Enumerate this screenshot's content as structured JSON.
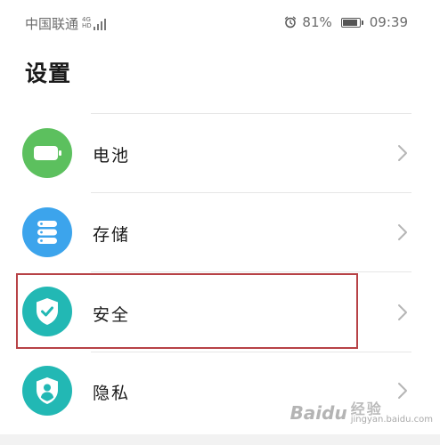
{
  "status_bar": {
    "carrier": "中国联通",
    "network_top": "4G",
    "network_bottom": "HD",
    "battery_percent": "81%",
    "time": "09:39",
    "icons": [
      "signal-icon",
      "alarm-icon",
      "battery-icon"
    ]
  },
  "page": {
    "title": "设置"
  },
  "settings_items": [
    {
      "label": "电池",
      "icon": "battery-icon",
      "color": "#5cc05e"
    },
    {
      "label": "存储",
      "icon": "storage-icon",
      "color": "#3ca4ec"
    },
    {
      "label": "安全",
      "icon": "shield-check-icon",
      "color": "#22b8b4"
    },
    {
      "label": "隐私",
      "icon": "privacy-shield-icon",
      "color": "#22b8b4"
    }
  ],
  "highlighted_item": "安全",
  "watermark": {
    "brand": "Baidu",
    "cn": "经验",
    "url": "jingyan.baidu.com"
  },
  "colors": {
    "highlight_border": "#b74246",
    "divider": "#e6e6e6",
    "chevron": "#b5b5b5"
  }
}
